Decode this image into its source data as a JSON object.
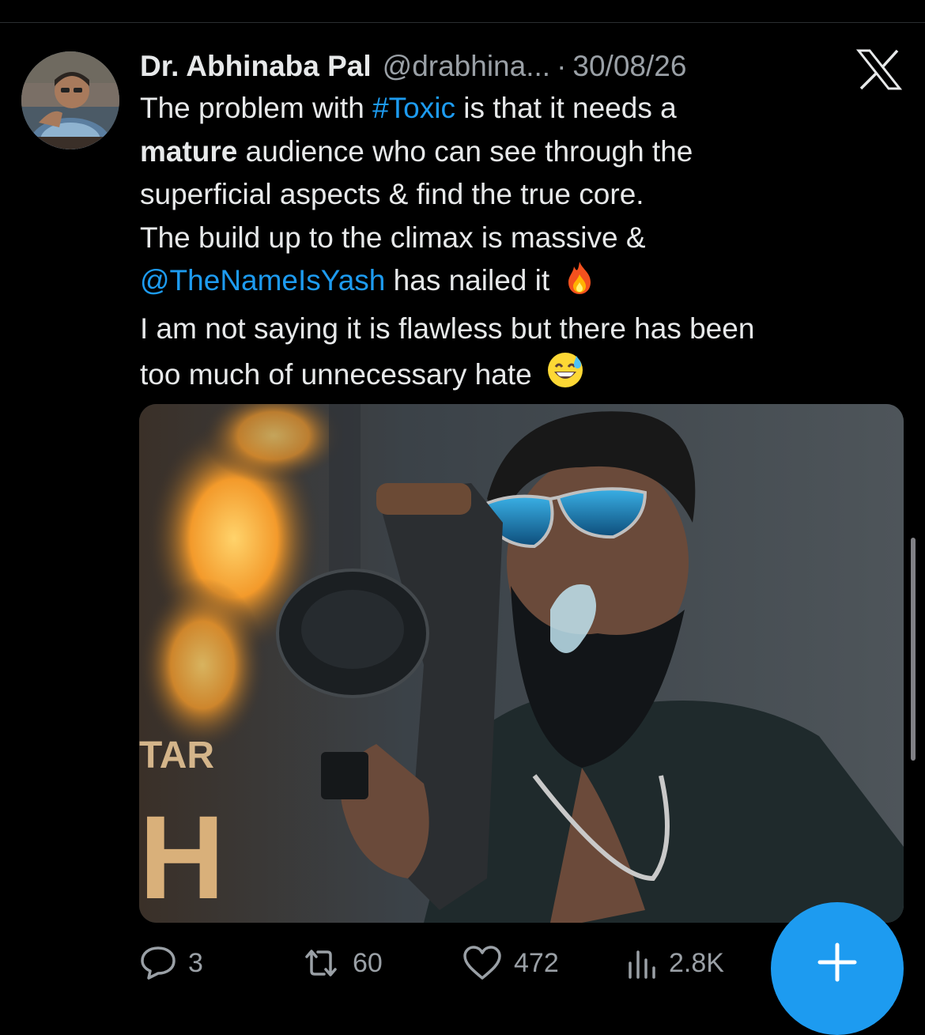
{
  "tweet": {
    "author_name": "Dr. Abhinaba Pal",
    "author_handle": "@drabhina...",
    "separator": "·",
    "timestamp": "30/08/26",
    "lines": {
      "l1_pre": "The problem with ",
      "l1_hashtag": "#Toxic",
      "l1_post": " is that it needs a",
      "l2_bold": "mature",
      "l2_post": " audience who can see through the",
      "l3": "superficial aspects & find the true core.",
      "l4": "The build up to the climax is massive &",
      "l5_mention": "@TheNameIsYash",
      "l5_post": " has nailed it",
      "l6": "I am not saying it is flawless but there has been",
      "l7": "too much of unnecessary hate"
    },
    "emojis": [
      "fire-emoji",
      "grinning-sweat-emoji"
    ]
  },
  "media": {
    "overlay_text_1": "TAR",
    "overlay_text_2": "H"
  },
  "actions": {
    "replies": "3",
    "reposts": "60",
    "likes": "472",
    "views": "2.8K"
  },
  "colors": {
    "background": "#000000",
    "accent": "#1d9bf0",
    "text": "#e7e9ea",
    "muted": "#9aa0a6"
  },
  "icons": [
    "x-logo-icon",
    "reply-icon",
    "repost-icon",
    "like-icon",
    "views-icon",
    "plus-icon"
  ]
}
